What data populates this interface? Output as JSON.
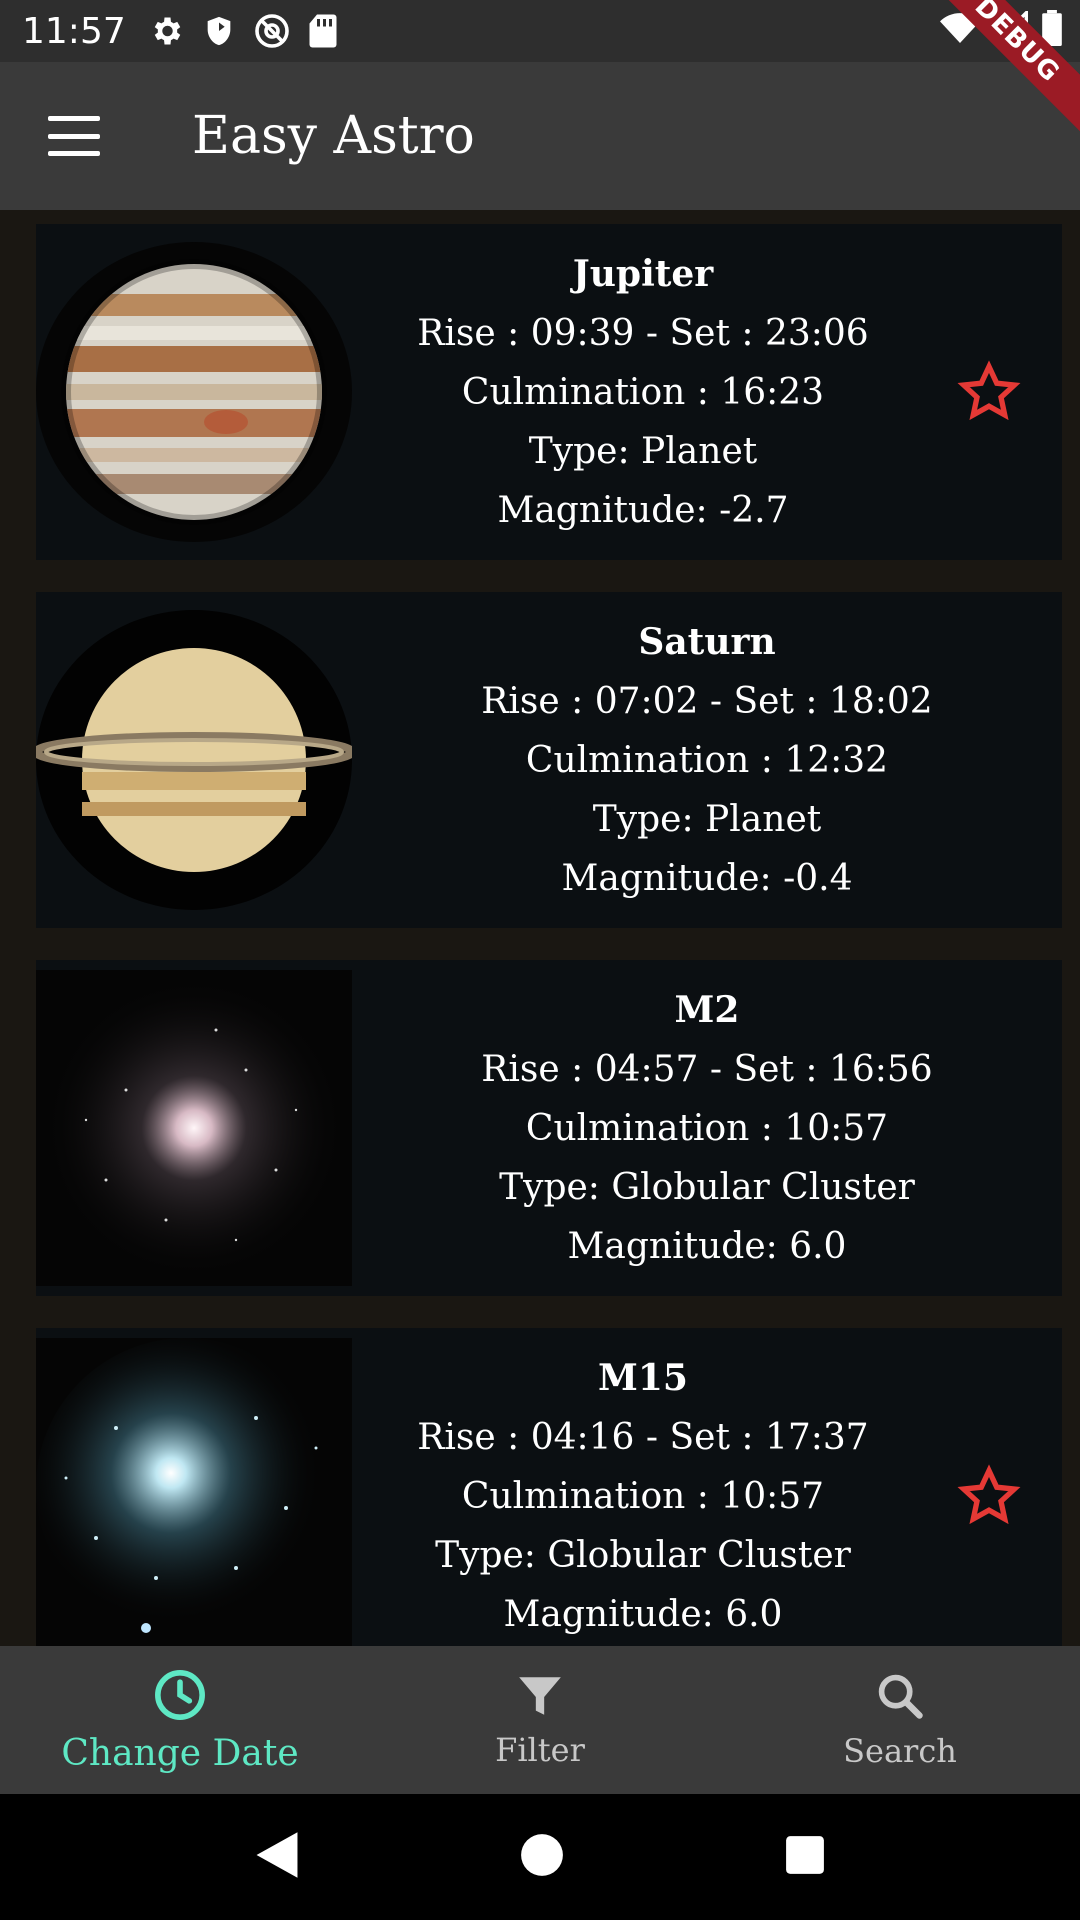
{
  "status_bar": {
    "time": "11:57",
    "debug_label": "DEBUG"
  },
  "app_bar": {
    "title": "Easy Astro",
    "menu_icon": "hamburger-menu-icon"
  },
  "objects": [
    {
      "name": "Jupiter",
      "rise_set": "Rise : 09:39 - Set : 23:06",
      "culmination": "Culmination : 16:23",
      "type": "Type: Planet",
      "magnitude": "Magnitude: -2.7",
      "favorite": true
    },
    {
      "name": "Saturn",
      "rise_set": "Rise : 07:02 - Set : 18:02",
      "culmination": "Culmination : 12:32",
      "type": "Type: Planet",
      "magnitude": "Magnitude: -0.4",
      "favorite": false
    },
    {
      "name": "M2",
      "rise_set": "Rise : 04:57 - Set : 16:56",
      "culmination": "Culmination : 10:57",
      "type": "Type: Globular Cluster",
      "magnitude": "Magnitude: 6.0",
      "favorite": false
    },
    {
      "name": "M15",
      "rise_set": "Rise : 04:16 - Set : 17:37",
      "culmination": "Culmination : 10:57",
      "type": "Type: Globular Cluster",
      "magnitude": "Magnitude: 6.0",
      "favorite": true
    }
  ],
  "bottom_nav": [
    {
      "label": "Change Date",
      "icon": "clock-icon",
      "active": true
    },
    {
      "label": "Filter",
      "icon": "filter-icon",
      "active": false
    },
    {
      "label": "Search",
      "icon": "search-icon",
      "active": false
    }
  ],
  "colors": {
    "accent": "#5ee8c4",
    "star": "#e53935",
    "app_bar": "#3a3a3a",
    "card": "#0b0f12"
  }
}
